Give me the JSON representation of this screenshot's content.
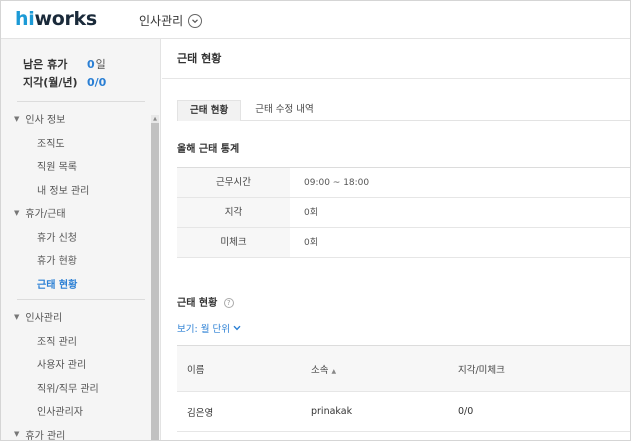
{
  "header": {
    "logo_hi": "hi",
    "logo_rest": "works",
    "app_name": "인사관리",
    "dropdown_icon": "chevron-down-circle-icon"
  },
  "sidebar": {
    "leave": [
      {
        "label": "남은 휴가",
        "value": "0",
        "unit": "일"
      },
      {
        "label": "지각(월/년)",
        "value": "0/0",
        "unit": ""
      }
    ],
    "menu": [
      {
        "type": "group",
        "label": "인사 정보"
      },
      {
        "type": "item",
        "label": "조직도"
      },
      {
        "type": "item",
        "label": "직원 목록"
      },
      {
        "type": "item",
        "label": "내 정보 관리"
      },
      {
        "type": "group",
        "label": "휴가/근태"
      },
      {
        "type": "item",
        "label": "휴가 신청"
      },
      {
        "type": "item",
        "label": "휴가 현황"
      },
      {
        "type": "item",
        "label": "근태 현황",
        "active": true
      },
      {
        "type": "gap"
      },
      {
        "type": "group",
        "label": "인사관리"
      },
      {
        "type": "item",
        "label": "조직 관리"
      },
      {
        "type": "item",
        "label": "사용자 관리"
      },
      {
        "type": "item",
        "label": "직위/직무 관리"
      },
      {
        "type": "item",
        "label": "인사관리자"
      },
      {
        "type": "group",
        "label": "휴가 관리"
      }
    ]
  },
  "main": {
    "title": "근태 현황",
    "tabs": [
      {
        "label": "근태 현황",
        "active": true
      },
      {
        "label": "근태 수정 내역",
        "active": false
      }
    ],
    "stats_heading": "올해 근태 통계",
    "stats": [
      {
        "key": "근무시간",
        "value": "09:00 ~ 18:00"
      },
      {
        "key": "지각",
        "value": "0회"
      },
      {
        "key": "미체크",
        "value": "0회"
      }
    ],
    "status_heading": "근태 현황",
    "help_icon_glyph": "?",
    "view_label": "보기: 월 단위",
    "columns": [
      "이름",
      "소속",
      "지각/미체크"
    ],
    "sort_glyph": "▲",
    "rows": [
      {
        "name": "김은영",
        "dept": "prinakak",
        "late": "0/0"
      }
    ]
  }
}
